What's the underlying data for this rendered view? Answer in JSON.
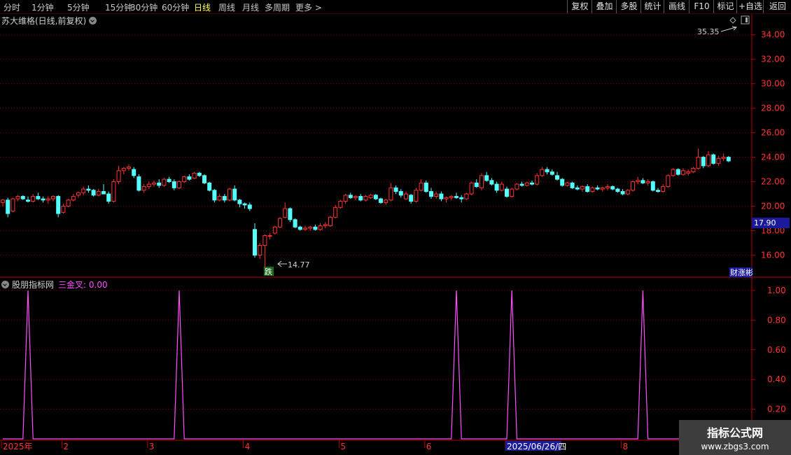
{
  "toolbar": {
    "periods": [
      "分时",
      "1分钟",
      "5分钟",
      "15分钟",
      "30分钟",
      "60分钟",
      "日线",
      "周线",
      "月线",
      "多周期",
      "更多 >"
    ],
    "active_period": "日线",
    "actions": [
      "复权",
      "叠加",
      "多股",
      "统计",
      "画线",
      "F10",
      "标记",
      "+自选",
      "返回"
    ]
  },
  "stock": {
    "title": "苏大维格(日线,前复权)"
  },
  "price_panel": {
    "high_label": "35.35",
    "low_label": "14.77",
    "current_price": "17.90",
    "event_marker": "跌",
    "corner_label": "财涨彬"
  },
  "indicator": {
    "source": "股朋指标网",
    "line_label": "三金叉: 0.00"
  },
  "watermark": {
    "line1": "指标公式网",
    "line2": "www.zbgs3.com"
  },
  "colors": {
    "up": "#ff3232",
    "down": "#54ffff",
    "indicator": "#ff50ff",
    "grid": "#8b0000",
    "axis": "#b00000",
    "active": "#ffff54"
  },
  "chart_data": [
    {
      "type": "candlestick",
      "ylim": [
        14.2,
        35.7
      ],
      "yticks": [
        16,
        18,
        20,
        22,
        24,
        26,
        28,
        30,
        32,
        34
      ],
      "grid": true,
      "candles": [
        [
          20.3,
          20.6,
          20.0,
          20.5
        ],
        [
          20.5,
          20.7,
          19.1,
          19.4
        ],
        [
          19.6,
          20.7,
          19.5,
          20.6
        ],
        [
          20.6,
          20.9,
          20.4,
          20.8
        ],
        [
          20.8,
          20.9,
          20.5,
          20.6
        ],
        [
          20.5,
          20.8,
          20.3,
          20.4
        ],
        [
          20.4,
          21.0,
          20.3,
          20.8
        ],
        [
          20.8,
          21.1,
          20.5,
          20.6
        ],
        [
          20.6,
          20.8,
          20.3,
          20.5
        ],
        [
          20.5,
          20.8,
          20.2,
          20.6
        ],
        [
          20.6,
          20.9,
          20.4,
          20.8
        ],
        [
          20.8,
          20.9,
          19.1,
          19.4
        ],
        [
          19.5,
          20.2,
          19.4,
          20.0
        ],
        [
          20.0,
          20.6,
          19.9,
          20.5
        ],
        [
          20.5,
          21.0,
          20.4,
          20.8
        ],
        [
          20.9,
          21.2,
          20.7,
          21.1
        ],
        [
          21.1,
          21.6,
          20.9,
          21.4
        ],
        [
          21.4,
          21.7,
          21.1,
          21.3
        ],
        [
          21.3,
          21.4,
          20.8,
          20.9
        ],
        [
          20.9,
          21.4,
          20.8,
          21.2
        ],
        [
          21.2,
          21.8,
          21.0,
          21.0
        ],
        [
          21.0,
          21.2,
          20.2,
          20.4
        ],
        [
          20.4,
          22.2,
          20.3,
          22.0
        ],
        [
          22.0,
          23.3,
          21.8,
          22.9
        ],
        [
          22.9,
          23.2,
          22.6,
          23.1
        ],
        [
          23.1,
          23.4,
          22.9,
          23.2
        ],
        [
          23.0,
          23.2,
          22.3,
          22.5
        ],
        [
          22.4,
          22.6,
          21.2,
          21.3
        ],
        [
          21.3,
          21.8,
          21.1,
          21.6
        ],
        [
          21.6,
          22.0,
          21.4,
          21.8
        ],
        [
          21.8,
          22.1,
          21.6,
          21.9
        ],
        [
          21.9,
          22.2,
          21.5,
          21.7
        ],
        [
          21.7,
          22.3,
          21.6,
          22.2
        ],
        [
          22.2,
          22.4,
          21.9,
          22.0
        ],
        [
          22.0,
          22.2,
          21.3,
          21.5
        ],
        [
          21.5,
          22.1,
          21.4,
          22.0
        ],
        [
          22.0,
          22.5,
          21.9,
          22.4
        ],
        [
          22.4,
          22.6,
          22.1,
          22.2
        ],
        [
          22.3,
          22.8,
          22.2,
          22.7
        ],
        [
          22.7,
          22.8,
          22.4,
          22.5
        ],
        [
          22.5,
          22.6,
          21.8,
          21.9
        ],
        [
          21.9,
          22.0,
          21.2,
          21.3
        ],
        [
          21.3,
          21.4,
          20.3,
          20.5
        ],
        [
          20.5,
          21.0,
          20.4,
          20.8
        ],
        [
          20.8,
          21.0,
          20.3,
          20.5
        ],
        [
          20.5,
          21.5,
          20.4,
          21.4
        ],
        [
          21.4,
          21.7,
          20.4,
          20.5
        ],
        [
          20.5,
          20.6,
          19.9,
          20.2
        ],
        [
          20.2,
          20.3,
          19.8,
          20.1
        ],
        [
          20.1,
          20.3,
          19.6,
          19.8
        ],
        [
          18.1,
          18.6,
          15.8,
          16.0
        ],
        [
          16.0,
          17.0,
          15.7,
          16.8
        ],
        [
          16.8,
          17.7,
          14.8,
          17.6
        ],
        [
          17.6,
          17.8,
          17.3,
          17.6
        ],
        [
          17.8,
          18.4,
          17.7,
          18.3
        ],
        [
          18.3,
          19.1,
          18.2,
          19.0
        ],
        [
          19.1,
          20.3,
          19.0,
          19.8
        ],
        [
          19.8,
          19.9,
          18.7,
          18.9
        ],
        [
          18.9,
          19.0,
          18.2,
          18.3
        ],
        [
          18.3,
          18.4,
          18.0,
          18.1
        ],
        [
          18.1,
          18.4,
          18.0,
          18.2
        ],
        [
          18.2,
          18.4,
          18.0,
          18.3
        ],
        [
          18.3,
          18.5,
          18.0,
          18.1
        ],
        [
          18.1,
          18.6,
          18.0,
          18.4
        ],
        [
          18.4,
          18.7,
          18.2,
          18.5
        ],
        [
          18.4,
          19.2,
          18.3,
          19.1
        ],
        [
          19.1,
          20.1,
          19.0,
          19.9
        ],
        [
          19.9,
          20.5,
          19.8,
          20.4
        ],
        [
          20.4,
          21.0,
          20.2,
          20.9
        ],
        [
          20.9,
          21.1,
          20.6,
          20.7
        ],
        [
          20.7,
          20.9,
          20.5,
          20.8
        ],
        [
          20.8,
          21.0,
          20.4,
          20.5
        ],
        [
          20.5,
          20.9,
          20.4,
          20.8
        ],
        [
          20.7,
          21.0,
          20.6,
          20.9
        ],
        [
          20.9,
          21.0,
          20.5,
          20.6
        ],
        [
          20.6,
          20.7,
          20.2,
          20.3
        ],
        [
          20.3,
          20.6,
          20.1,
          20.5
        ],
        [
          20.5,
          21.9,
          20.4,
          21.5
        ],
        [
          21.5,
          21.7,
          21.0,
          21.2
        ],
        [
          21.2,
          21.4,
          20.7,
          20.9
        ],
        [
          20.6,
          21.2,
          20.5,
          21.0
        ],
        [
          20.9,
          21.0,
          20.2,
          20.4
        ],
        [
          20.4,
          21.5,
          20.3,
          21.3
        ],
        [
          21.3,
          22.2,
          21.2,
          21.9
        ],
        [
          21.9,
          22.1,
          21.1,
          21.2
        ],
        [
          21.2,
          21.5,
          20.6,
          20.8
        ],
        [
          20.8,
          21.2,
          20.6,
          21.0
        ],
        [
          21.0,
          21.2,
          20.4,
          20.6
        ],
        [
          20.6,
          20.8,
          20.3,
          20.7
        ],
        [
          20.7,
          20.9,
          20.5,
          20.8
        ],
        [
          20.8,
          21.1,
          20.6,
          20.7
        ],
        [
          20.7,
          20.9,
          20.3,
          20.6
        ],
        [
          20.6,
          21.1,
          20.5,
          21.0
        ],
        [
          21.0,
          22.0,
          20.9,
          21.9
        ],
        [
          21.9,
          22.2,
          21.5,
          21.6
        ],
        [
          21.5,
          22.7,
          21.3,
          22.5
        ],
        [
          22.5,
          22.8,
          22.0,
          22.1
        ],
        [
          22.1,
          22.3,
          21.7,
          21.8
        ],
        [
          21.8,
          22.0,
          21.1,
          21.3
        ],
        [
          21.3,
          22.0,
          21.2,
          21.8
        ],
        [
          21.4,
          21.6,
          20.7,
          20.8
        ],
        [
          20.8,
          21.5,
          20.7,
          21.4
        ],
        [
          21.4,
          21.9,
          21.3,
          21.8
        ],
        [
          21.8,
          22.0,
          21.6,
          21.7
        ],
        [
          21.7,
          22.0,
          21.6,
          21.9
        ],
        [
          21.9,
          22.1,
          21.7,
          21.8
        ],
        [
          21.8,
          22.7,
          21.7,
          22.5
        ],
        [
          22.5,
          23.2,
          22.4,
          23.0
        ],
        [
          23.0,
          23.2,
          22.6,
          22.8
        ],
        [
          22.8,
          23.0,
          22.5,
          22.6
        ],
        [
          22.5,
          22.8,
          22.1,
          22.2
        ],
        [
          22.2,
          22.3,
          21.6,
          21.7
        ],
        [
          21.7,
          22.0,
          21.6,
          21.9
        ],
        [
          21.9,
          22.0,
          21.4,
          21.5
        ],
        [
          21.5,
          21.7,
          21.3,
          21.4
        ],
        [
          21.4,
          21.7,
          21.2,
          21.6
        ],
        [
          21.6,
          21.8,
          21.1,
          21.2
        ],
        [
          21.2,
          21.6,
          21.1,
          21.5
        ],
        [
          21.5,
          21.7,
          21.3,
          21.4
        ],
        [
          21.4,
          21.6,
          21.2,
          21.5
        ],
        [
          21.5,
          21.8,
          21.3,
          21.6
        ],
        [
          21.6,
          21.7,
          21.3,
          21.4
        ],
        [
          21.4,
          21.5,
          21.1,
          21.2
        ],
        [
          21.2,
          21.4,
          20.9,
          21.0
        ],
        [
          21.0,
          21.4,
          20.9,
          21.3
        ],
        [
          21.3,
          22.1,
          21.2,
          22.0
        ],
        [
          22.0,
          22.4,
          21.8,
          22.1
        ],
        [
          22.1,
          22.3,
          21.8,
          21.9
        ],
        [
          21.9,
          22.2,
          21.7,
          22.0
        ],
        [
          22.0,
          22.1,
          21.2,
          21.3
        ],
        [
          21.3,
          21.5,
          21.1,
          21.2
        ],
        [
          21.2,
          21.8,
          21.1,
          21.6
        ],
        [
          21.6,
          22.6,
          21.5,
          22.5
        ],
        [
          22.5,
          23.1,
          22.4,
          23.0
        ],
        [
          23.0,
          23.1,
          22.5,
          22.6
        ],
        [
          22.6,
          23.1,
          22.5,
          22.9
        ],
        [
          22.7,
          23.0,
          22.5,
          22.8
        ],
        [
          22.8,
          23.2,
          22.7,
          23.1
        ],
        [
          23.1,
          24.7,
          23.0,
          24.0
        ],
        [
          24.0,
          24.1,
          23.1,
          23.3
        ],
        [
          23.3,
          24.5,
          23.2,
          24.2
        ],
        [
          24.2,
          24.3,
          23.4,
          23.5
        ],
        [
          23.5,
          24.1,
          23.3,
          23.9
        ],
        [
          23.9,
          24.3,
          23.7,
          24.0
        ],
        [
          24.0,
          24.1,
          23.6,
          23.7
        ]
      ]
    },
    {
      "type": "line",
      "name": "三金叉",
      "ylim": [
        0,
        1.08
      ],
      "yticks": [
        0.2,
        0.4,
        0.6,
        0.8,
        1.0
      ],
      "spikes_at": [
        5,
        35,
        90,
        101,
        127
      ],
      "x_labels": [
        {
          "index": 0,
          "text": "2025年"
        },
        {
          "index": 12,
          "text": "2"
        },
        {
          "index": 29,
          "text": "3"
        },
        {
          "index": 48,
          "text": "4"
        },
        {
          "index": 67,
          "text": "5"
        },
        {
          "index": 84,
          "text": "6"
        },
        {
          "index": 100,
          "text": "2025/06/26/四"
        },
        {
          "index": 123,
          "text": "8"
        }
      ]
    }
  ]
}
